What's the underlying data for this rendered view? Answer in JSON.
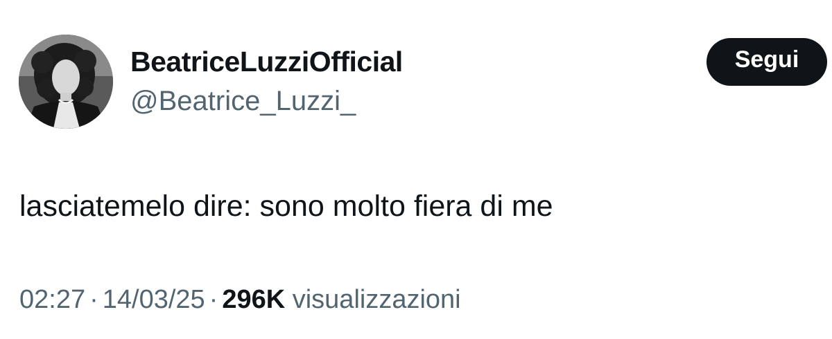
{
  "author": {
    "display_name": "BeatriceLuzziOfficial",
    "handle": "@Beatrice_Luzzi_"
  },
  "follow_button": {
    "label": "Segui"
  },
  "tweet": {
    "text": "lasciatemelo dire: sono molto fiera di me"
  },
  "meta": {
    "time": "02:27",
    "separator": "·",
    "date": "14/03/25",
    "views_count": "296K",
    "views_label": "visualizzazioni"
  }
}
